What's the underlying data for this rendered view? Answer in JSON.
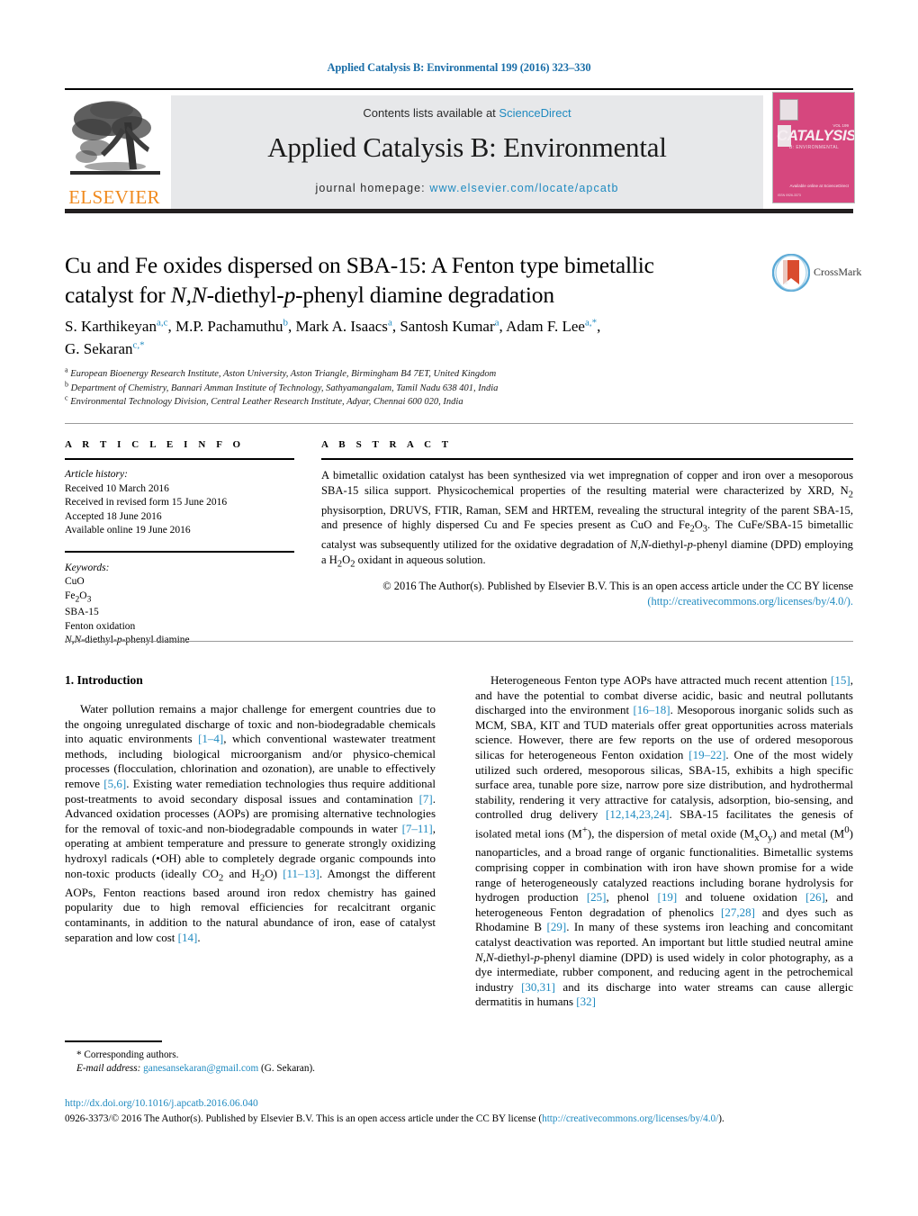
{
  "running_head": "Applied Catalysis B: Environmental 199 (2016) 323–330",
  "masthead": {
    "publisher_name": "ELSEVIER",
    "contents_prefix": "Contents lists available at ",
    "contents_link": "ScienceDirect",
    "journal_title": "Applied Catalysis B: Environmental",
    "homepage_prefix": "journal homepage: ",
    "homepage_url": "www.elsevier.com/locate/apcatb",
    "cover": {
      "big_word": "CATALYSIS",
      "subtitle": "B: ENVIRONMENTAL",
      "top_right_tiny": "VOL 199",
      "bottom_right": "Available online at\nScienceDirect",
      "bottom_left": "ISSN 0926-3373"
    },
    "colors": {
      "link_blue": "#1f8ac0",
      "elsevier_orange": "#f08a1e",
      "cover_pink": "#d6477e",
      "panel_gray": "#e7e8ea"
    }
  },
  "article": {
    "title_line1": "Cu and Fe oxides dispersed on SBA-15: A Fenton type bimetallic",
    "title_line2_a": "catalyst for ",
    "title_line2_italic": "N,N",
    "title_line2_b": "-diethyl-",
    "title_line2_italic2": "p",
    "title_line2_c": "-phenyl diamine degradation",
    "crossmark_label": "CrossMark",
    "authors": [
      {
        "name": "S. Karthikeyan",
        "marks": "a,c",
        "star": false
      },
      {
        "name": "M.P. Pachamuthu",
        "marks": "b",
        "star": false
      },
      {
        "name": "Mark A. Isaacs",
        "marks": "a",
        "star": false
      },
      {
        "name": "Santosh Kumar",
        "marks": "a",
        "star": false
      },
      {
        "name": "Adam F. Lee",
        "marks": "a,",
        "star": true
      },
      {
        "name": "G. Sekaran",
        "marks": "c,",
        "star": true
      }
    ],
    "affiliations": [
      {
        "mark": "a",
        "text": "European Bioenergy Research Institute, Aston University, Aston Triangle, Birmingham B4 7ET, United Kingdom"
      },
      {
        "mark": "b",
        "text": "Department of Chemistry, Bannari Amman Institute of Technology, Sathyamangalam, Tamil Nadu 638 401, India"
      },
      {
        "mark": "c",
        "text": "Environmental Technology Division, Central Leather Research Institute, Adyar, Chennai 600 020, India"
      }
    ]
  },
  "article_info": {
    "heading": "A R T I C L E   I N F O",
    "history_label": "Article history:",
    "history": [
      "Received 10 March 2016",
      "Received in revised form 15 June 2016",
      "Accepted 18 June 2016",
      "Available online 19 June 2016"
    ],
    "keywords_label": "Keywords:",
    "keywords": [
      "CuO",
      "Fe2O3",
      "SBA-15",
      "Fenton oxidation",
      "N,N-diethyl-p-phenyl diamine"
    ]
  },
  "abstract": {
    "heading": "A B S T R A C T",
    "text": "A bimetallic oxidation catalyst has been synthesized via wet impregnation of copper and iron over a mesoporous SBA-15 silica support. Physicochemical properties of the resulting material were characterized by XRD, N2 physisorption, DRUVS, FTIR, Raman, SEM and HRTEM, revealing the structural integrity of the parent SBA-15, and presence of highly dispersed Cu and Fe species present as CuO and Fe2O3. The CuFe/SBA-15 bimetallic catalyst was subsequently utilized for the oxidative degradation of N,N-diethyl-p-phenyl diamine (DPD) employing a H2O2 oxidant in aqueous solution.",
    "copyright": "© 2016 The Author(s). Published by Elsevier B.V. This is an open access article under the CC BY license",
    "license_url": "(http://creativecommons.org/licenses/by/4.0/)."
  },
  "body": {
    "section_heading": "1.  Introduction",
    "left_paragraph": "Water pollution remains a major challenge for emergent countries due to the ongoing unregulated discharge of toxic and non-biodegradable chemicals into aquatic environments [1–4], which conventional wastewater treatment methods, including biological microorganism and/or physico-chemical processes (flocculation, chlorination and ozonation), are unable to effectively remove [5,6]. Existing water remediation technologies thus require additional post-treatments to avoid secondary disposal issues and contamination [7]. Advanced oxidation processes (AOPs) are promising alternative technologies for the removal of toxic-and non-biodegradable compounds in water [7–11], operating at ambient temperature and pressure to generate strongly oxidizing hydroxyl radicals (•OH) able to completely degrade organic compounds into non-toxic products (ideally CO2 and H2O) [11–13]. Amongst the different AOPs, Fenton reactions based around iron redox chemistry has gained popularity due to high removal efficiencies for recalcitrant organic contaminants, in addition to the natural abundance of iron, ease of catalyst separation and low cost [14].",
    "right_paragraph": "Heterogeneous Fenton type AOPs have attracted much recent attention [15], and have the potential to combat diverse acidic, basic and neutral pollutants discharged into the environment [16–18]. Mesoporous inorganic solids such as MCM, SBA, KIT and TUD materials offer great opportunities across materials science. However, there are few reports on the use of ordered mesoporous silicas for heterogeneous Fenton oxidation [19–22]. One of the most widely utilized such ordered, mesoporous silicas, SBA-15, exhibits a high specific surface area, tunable pore size, narrow pore size distribution, and hydrothermal stability, rendering it very attractive for catalysis, adsorption, bio-sensing, and controlled drug delivery [12,14,23,24]. SBA-15 facilitates the genesis of isolated metal ions (M+), the dispersion of metal oxide (MxOy) and metal (M0) nanoparticles, and a broad range of organic functionalities. Bimetallic systems comprising copper in combination with iron have shown promise for a wide range of heterogeneously catalyzed reactions including borane hydrolysis for hydrogen production [25], phenol [19] and toluene oxidation [26], and heterogeneous Fenton degradation of phenolics [27,28] and dyes such as Rhodamine B [29]. In many of these systems iron leaching and concomitant catalyst deactivation was reported. An important but little studied neutral amine N,N-diethyl-p-phenyl diamine (DPD) is used widely in color photography, as a dye intermediate, rubber component, and reducing agent in the petrochemical industry [30,31] and its discharge into water streams can cause allergic dermatitis in humans [32]"
  },
  "footnote": {
    "star_line": "*  Corresponding authors.",
    "email_label": "E-mail address:",
    "email": "ganesansekaran@gmail.com",
    "email_owner": "(G. Sekaran)."
  },
  "bottom": {
    "doi": "http://dx.doi.org/10.1016/j.apcatb.2016.06.040",
    "issn_text": "0926-3373/© 2016 The Author(s). Published by Elsevier B.V. This is an open access article under the CC BY license (",
    "issn_license_url": "http://creativecommons.org/licenses/by/4.0/",
    "issn_tail": ")."
  }
}
